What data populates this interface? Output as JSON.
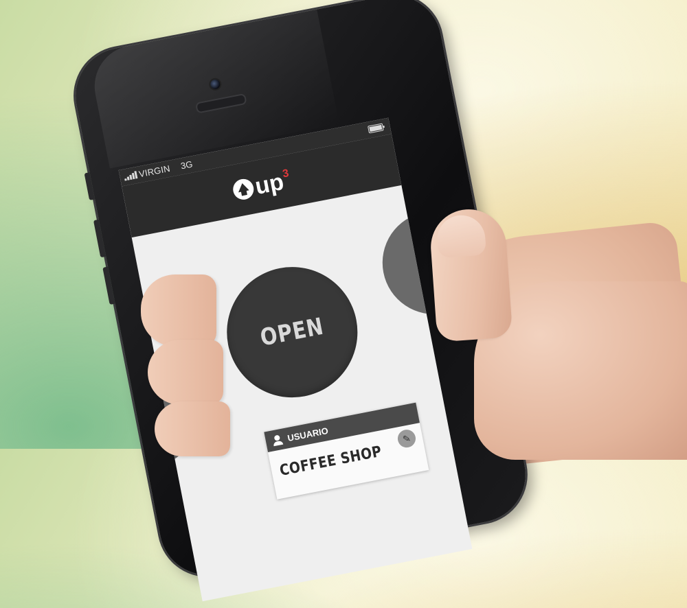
{
  "statusbar": {
    "carrier": "VIRGIN",
    "network": "3G"
  },
  "app": {
    "logo_text": "up",
    "logo_superscript": "3",
    "accent_color": "#e0393b"
  },
  "main": {
    "center_button_label": "OPEN"
  },
  "user_card": {
    "header_label": "USUARIO",
    "name": "COFFEE SHOP",
    "edit_icon": "pencil-icon"
  }
}
